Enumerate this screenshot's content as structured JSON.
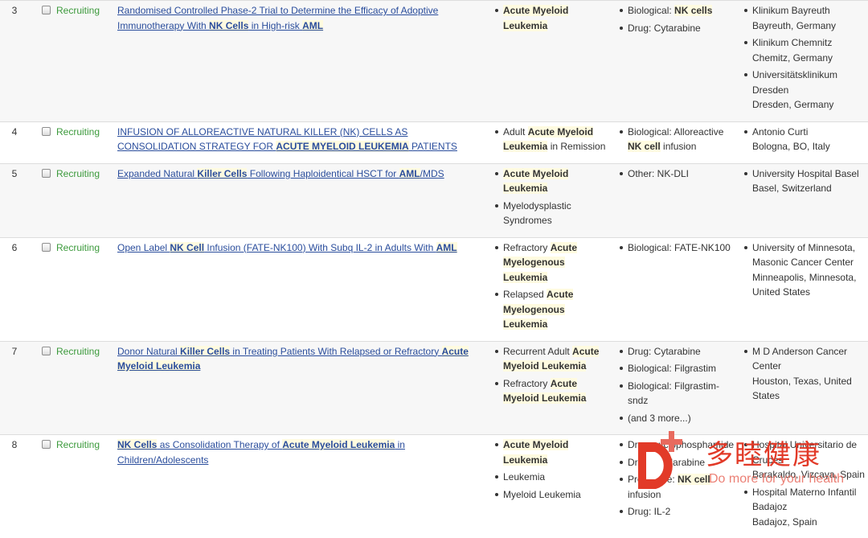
{
  "trials": [
    {
      "rank": "3",
      "status": "Recruiting",
      "title": [
        {
          "t": "Randomised Controlled Phase-2 Trial to Determine the Efficacy of Adoptive Immunotherapy With "
        },
        {
          "t": "NK Cells",
          "b": true
        },
        {
          "t": " in High-risk "
        },
        {
          "t": "AML",
          "b": true
        }
      ],
      "conditions": [
        [
          {
            "t": "Acute Myeloid Leukemia",
            "b": true
          }
        ]
      ],
      "interventions": [
        [
          {
            "t": "Biological: "
          },
          {
            "t": "NK cells",
            "b": true
          }
        ],
        [
          {
            "t": "Drug: Cytarabine"
          }
        ]
      ],
      "locations": [
        [
          "Klinikum Bayreuth",
          "Bayreuth, Germany"
        ],
        [
          "Klinikum Chemnitz",
          "Chemitz, Germany"
        ],
        [
          "Universitätsklinikum Dresden",
          "Dresden, Germany"
        ]
      ]
    },
    {
      "rank": "4",
      "status": "Recruiting",
      "title": [
        {
          "t": "INFUSION OF ALLOREACTIVE NATURAL KILLER (NK) CELLS AS CONSOLIDATION STRATEGY FOR "
        },
        {
          "t": "ACUTE MYELOID LEUKEMIA",
          "b": true
        },
        {
          "t": " PATIENTS"
        }
      ],
      "conditions": [
        [
          {
            "t": "Adult "
          },
          {
            "t": "Acute Myeloid Leukemia",
            "b": true
          },
          {
            "t": " in Remission"
          }
        ]
      ],
      "interventions": [
        [
          {
            "t": "Biological: Alloreactive "
          },
          {
            "t": "NK cell",
            "b": true
          },
          {
            "t": " infusion"
          }
        ]
      ],
      "locations": [
        [
          "Antonio Curti",
          "Bologna, BO, Italy"
        ]
      ]
    },
    {
      "rank": "5",
      "status": "Recruiting",
      "title": [
        {
          "t": "Expanded Natural "
        },
        {
          "t": "Killer Cells",
          "b": true
        },
        {
          "t": " Following Haploidentical HSCT for "
        },
        {
          "t": "AML",
          "b": true
        },
        {
          "t": "/MDS"
        }
      ],
      "conditions": [
        [
          {
            "t": "Acute Myeloid Leukemia",
            "b": true
          }
        ],
        [
          {
            "t": "Myelodysplastic Syndromes"
          }
        ]
      ],
      "interventions": [
        [
          {
            "t": "Other: NK-DLI"
          }
        ]
      ],
      "locations": [
        [
          "University Hospital Basel",
          "Basel, Switzerland"
        ]
      ]
    },
    {
      "rank": "6",
      "status": "Recruiting",
      "title": [
        {
          "t": "Open Label "
        },
        {
          "t": "NK Cell",
          "b": true
        },
        {
          "t": " Infusion (FATE-NK100) With Subq IL-2 in Adults With "
        },
        {
          "t": "AML",
          "b": true
        }
      ],
      "conditions": [
        [
          {
            "t": "Refractory "
          },
          {
            "t": "Acute Myelogenous Leukemia",
            "b": true
          }
        ],
        [
          {
            "t": "Relapsed "
          },
          {
            "t": "Acute Myelogenous Leukemia",
            "b": true
          }
        ]
      ],
      "interventions": [
        [
          {
            "t": "Biological: FATE-NK100"
          }
        ]
      ],
      "locations": [
        [
          "University of Minnesota, Masonic Cancer Center",
          "Minneapolis, Minnesota, United States"
        ]
      ]
    },
    {
      "rank": "7",
      "status": "Recruiting",
      "title": [
        {
          "t": "Donor Natural "
        },
        {
          "t": "Killer Cells",
          "b": true
        },
        {
          "t": " in Treating Patients With Relapsed or Refractory "
        },
        {
          "t": "Acute Myeloid Leukemia",
          "b": true
        }
      ],
      "conditions": [
        [
          {
            "t": "Recurrent Adult "
          },
          {
            "t": "Acute Myeloid Leukemia",
            "b": true
          }
        ],
        [
          {
            "t": "Refractory "
          },
          {
            "t": "Acute Myeloid Leukemia",
            "b": true
          }
        ]
      ],
      "interventions": [
        [
          {
            "t": "Drug: Cytarabine"
          }
        ],
        [
          {
            "t": "Biological: Filgrastim"
          }
        ],
        [
          {
            "t": "Biological: Filgrastim-sndz"
          }
        ],
        [
          {
            "t": "(and 3 more...)"
          }
        ]
      ],
      "locations": [
        [
          "M D Anderson Cancer Center",
          "Houston, Texas, United States"
        ]
      ]
    },
    {
      "rank": "8",
      "status": "Recruiting",
      "title": [
        {
          "t": "NK Cells",
          "b": true
        },
        {
          "t": " as Consolidation Therapy of "
        },
        {
          "t": "Acute Myeloid Leukemia",
          "b": true
        },
        {
          "t": " in Children/Adolescents"
        }
      ],
      "conditions": [
        [
          {
            "t": "Acute Myeloid Leukemia",
            "b": true
          }
        ],
        [
          {
            "t": "Leukemia"
          }
        ],
        [
          {
            "t": "Myeloid Leukemia"
          }
        ]
      ],
      "interventions": [
        [
          {
            "t": "Drug: cyclophosphamide"
          }
        ],
        [
          {
            "t": "Drug: Fludarabine"
          }
        ],
        [
          {
            "t": "Procedure: "
          },
          {
            "t": "NK cell",
            "b": true
          },
          {
            "t": " infusion"
          }
        ],
        [
          {
            "t": "Drug: IL-2"
          }
        ]
      ],
      "locations": [
        [
          "Hospital Universitario de Cruces",
          "Barakaldo, Vizcaya, Spain"
        ],
        [
          "Hospital Materno Infantil Badajoz",
          "Badajoz, Spain"
        ]
      ]
    }
  ],
  "watermark": {
    "cn": "多睦健康",
    "en": "Do more for your health",
    "color": "#e23a28"
  }
}
